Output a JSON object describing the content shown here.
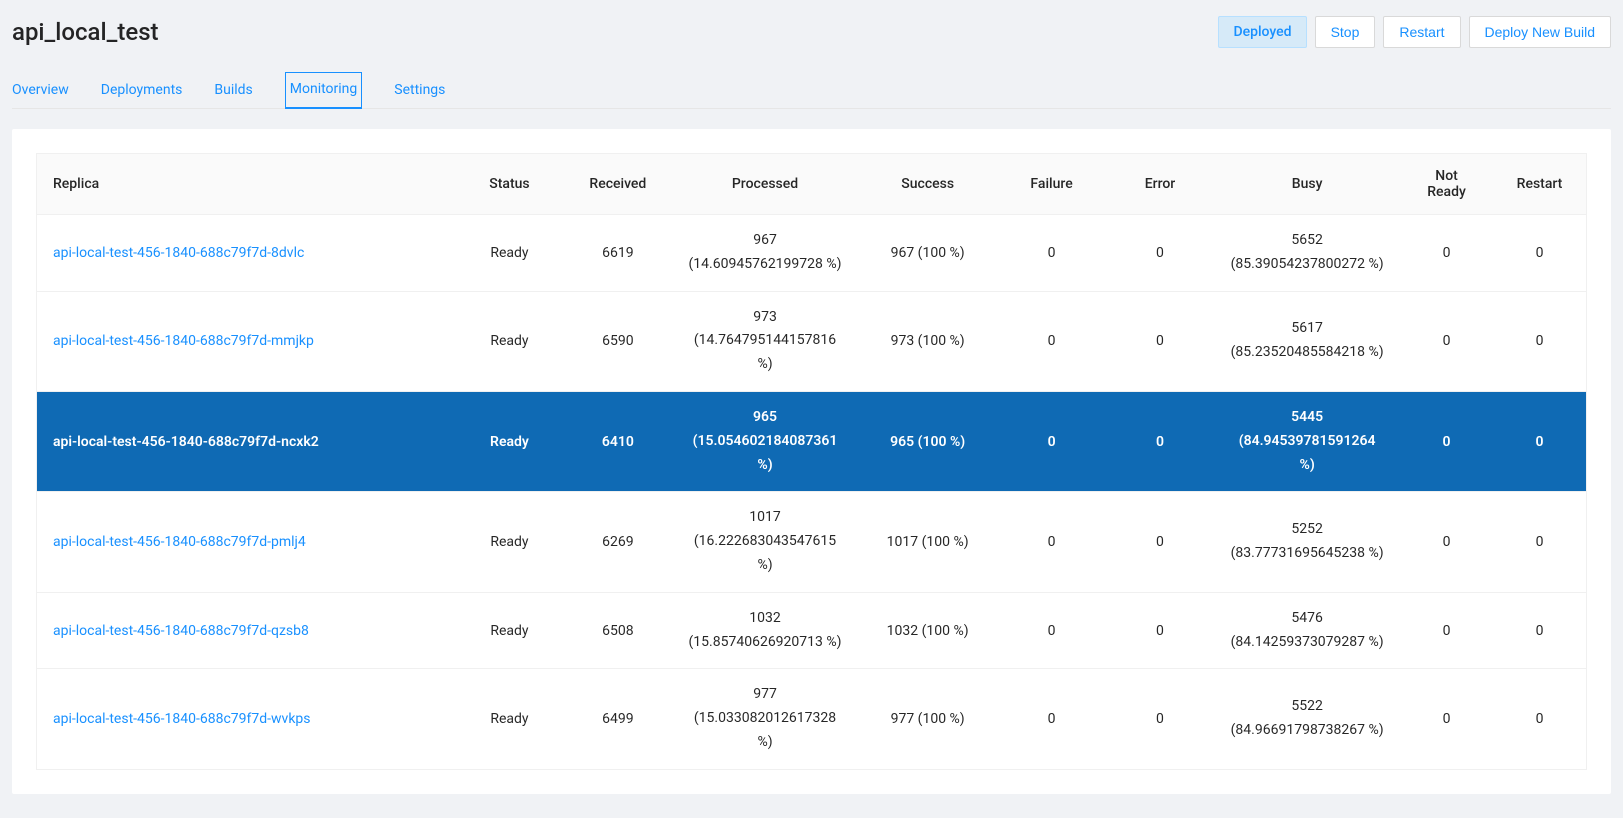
{
  "header": {
    "title": "api_local_test",
    "status_badge": "Deployed",
    "buttons": {
      "stop": "Stop",
      "restart": "Restart",
      "deploy_new_build": "Deploy New Build"
    }
  },
  "tabs": [
    {
      "label": "Overview",
      "active": false
    },
    {
      "label": "Deployments",
      "active": false
    },
    {
      "label": "Builds",
      "active": false
    },
    {
      "label": "Monitoring",
      "active": true
    },
    {
      "label": "Settings",
      "active": false
    }
  ],
  "table": {
    "columns": {
      "replica": "Replica",
      "status": "Status",
      "received": "Received",
      "processed": "Processed",
      "success": "Success",
      "failure": "Failure",
      "error": "Error",
      "busy": "Busy",
      "not_ready": "Not Ready",
      "restart": "Restart"
    },
    "rows": [
      {
        "replica": "api-local-test-456-1840-688c79f7d-8dvlc",
        "status": "Ready",
        "received": "6619",
        "processed": "967 (14.60945762199728 %)",
        "success": "967 (100 %)",
        "failure": "0",
        "error": "0",
        "busy": "5652 (85.39054237800272 %)",
        "not_ready": "0",
        "restart": "0",
        "selected": false
      },
      {
        "replica": "api-local-test-456-1840-688c79f7d-mmjkp",
        "status": "Ready",
        "received": "6590",
        "processed": "973 (14.764795144157816 %)",
        "success": "973 (100 %)",
        "failure": "0",
        "error": "0",
        "busy": "5617 (85.23520485584218 %)",
        "not_ready": "0",
        "restart": "0",
        "selected": false
      },
      {
        "replica": "api-local-test-456-1840-688c79f7d-ncxk2",
        "status": "Ready",
        "received": "6410",
        "processed": "965 (15.054602184087361 %)",
        "success": "965 (100 %)",
        "failure": "0",
        "error": "0",
        "busy": "5445 (84.94539781591264 %)",
        "not_ready": "0",
        "restart": "0",
        "selected": true
      },
      {
        "replica": "api-local-test-456-1840-688c79f7d-pmlj4",
        "status": "Ready",
        "received": "6269",
        "processed": "1017 (16.222683043547615 %)",
        "success": "1017 (100 %)",
        "failure": "0",
        "error": "0",
        "busy": "5252 (83.77731695645238 %)",
        "not_ready": "0",
        "restart": "0",
        "selected": false
      },
      {
        "replica": "api-local-test-456-1840-688c79f7d-qzsb8",
        "status": "Ready",
        "received": "6508",
        "processed": "1032 (15.85740626920713 %)",
        "success": "1032 (100 %)",
        "failure": "0",
        "error": "0",
        "busy": "5476 (84.14259373079287 %)",
        "not_ready": "0",
        "restart": "0",
        "selected": false
      },
      {
        "replica": "api-local-test-456-1840-688c79f7d-wvkps",
        "status": "Ready",
        "received": "6499",
        "processed": "977 (15.033082012617328 %)",
        "success": "977 (100 %)",
        "failure": "0",
        "error": "0",
        "busy": "5522 (84.96691798738267 %)",
        "not_ready": "0",
        "restart": "0",
        "selected": false
      }
    ]
  }
}
